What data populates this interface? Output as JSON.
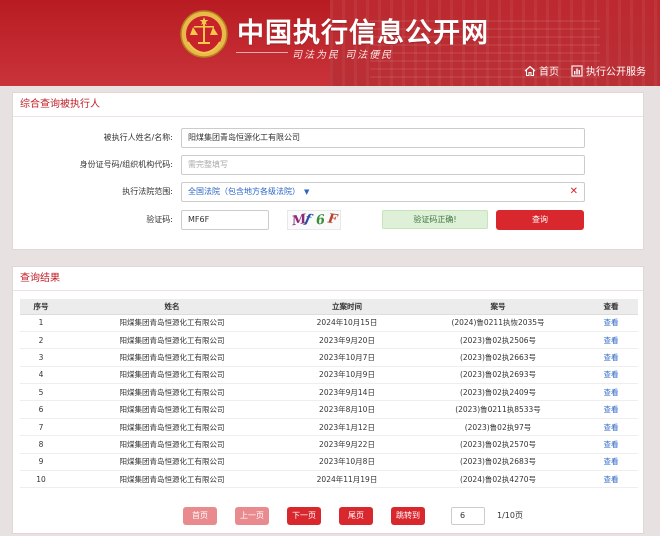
{
  "header": {
    "site_title": "中国执行信息公开网",
    "slogan": "司法为民  司法便民",
    "nav": [
      {
        "label": "首页",
        "icon": "home-icon"
      },
      {
        "label": "执行公开服务",
        "icon": "chart-icon"
      }
    ]
  },
  "search": {
    "title": "综合查询被执行人",
    "name_label": "被执行人姓名/名称:",
    "name_value": "阳煤集团青岛恒源化工有限公司",
    "id_label": "身份证号码/组织机构代码:",
    "id_placeholder": "需完整填写",
    "court_label": "执行法院范围:",
    "court_value": "全国法院（包含地方各级法院）",
    "captcha_label": "验证码:",
    "captcha_value": "MF6F",
    "captcha_image_text": [
      "M",
      "f",
      "6",
      "F"
    ],
    "captcha_status": "验证码正确!",
    "query_button": "查询"
  },
  "results": {
    "title": "查询结果",
    "columns": [
      "序号",
      "姓名",
      "立案时间",
      "案号",
      "查看"
    ],
    "rows": [
      {
        "no": "1",
        "name": "阳煤集团青岛恒源化工有限公司",
        "date": "2024年10月15日",
        "case": "(2024)鲁0211执恢2035号",
        "view": "查看"
      },
      {
        "no": "2",
        "name": "阳煤集团青岛恒源化工有限公司",
        "date": "2023年9月20日",
        "case": "(2023)鲁02执2506号",
        "view": "查看"
      },
      {
        "no": "3",
        "name": "阳煤集团青岛恒源化工有限公司",
        "date": "2023年10月7日",
        "case": "(2023)鲁02执2663号",
        "view": "查看"
      },
      {
        "no": "4",
        "name": "阳煤集团青岛恒源化工有限公司",
        "date": "2023年10月9日",
        "case": "(2023)鲁02执2693号",
        "view": "查看"
      },
      {
        "no": "5",
        "name": "阳煤集团青岛恒源化工有限公司",
        "date": "2023年9月14日",
        "case": "(2023)鲁02执2409号",
        "view": "查看"
      },
      {
        "no": "6",
        "name": "阳煤集团青岛恒源化工有限公司",
        "date": "2023年8月10日",
        "case": "(2023)鲁0211执8533号",
        "view": "查看"
      },
      {
        "no": "7",
        "name": "阳煤集团青岛恒源化工有限公司",
        "date": "2023年1月12日",
        "case": "(2023)鲁02执97号",
        "view": "查看"
      },
      {
        "no": "8",
        "name": "阳煤集团青岛恒源化工有限公司",
        "date": "2023年9月22日",
        "case": "(2023)鲁02执2570号",
        "view": "查看"
      },
      {
        "no": "9",
        "name": "阳煤集团青岛恒源化工有限公司",
        "date": "2023年10月8日",
        "case": "(2023)鲁02执2683号",
        "view": "查看"
      },
      {
        "no": "10",
        "name": "阳煤集团青岛恒源化工有限公司",
        "date": "2024年11月19日",
        "case": "(2024)鲁02执4270号",
        "view": "查看"
      }
    ]
  },
  "pagination": {
    "first": "首页",
    "prev": "上一页",
    "next": "下一页",
    "last": "尾页",
    "jump": "跳转到",
    "page_input": "6",
    "page_count": "1/10页"
  },
  "colors": {
    "brand_red": "#c01d25",
    "button_red": "#d9272e",
    "link_blue": "#2a64c5",
    "success_green": "#3c763d"
  }
}
